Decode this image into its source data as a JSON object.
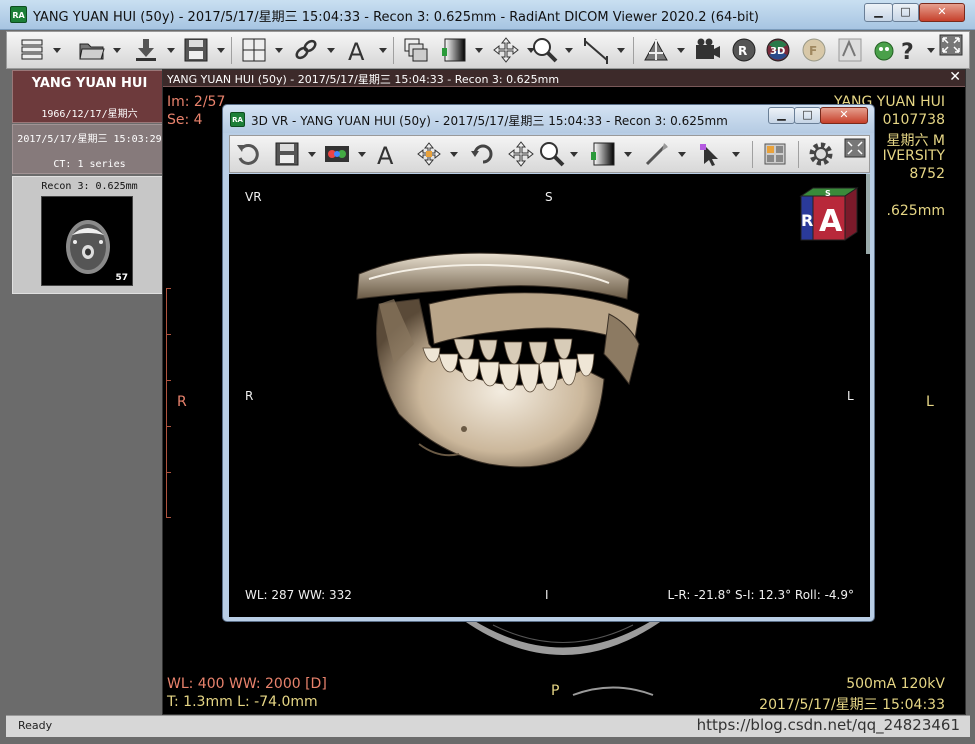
{
  "window": {
    "icon_text": "RA",
    "title": "YANG YUAN HUI (50y) - 2017/5/17/星期三 15:04:33 - Recon 3: 0.625mm - RadiAnt DICOM Viewer 2020.2 (64-bit)",
    "minimize": "▁",
    "maximize": "□",
    "close": "✕"
  },
  "toolbar": {
    "icons": [
      "menu-icon",
      "open-folder-icon",
      "download-icon",
      "save-icon",
      "layout-icon",
      "link-icon",
      "annotation-text-icon",
      "stack-icon",
      "window-level-icon",
      "pan-icon",
      "zoom-icon",
      "measure-icon",
      "mpr-icon",
      "video-icon",
      "mpr-r-icon",
      "3d-icon",
      "fusion-icon",
      "flip-icon",
      "support-icon",
      "help-icon",
      "fullscreen-icon"
    ]
  },
  "patient": {
    "name": "YANG YUAN HUI",
    "dob": "1966/12/17/星期六"
  },
  "study": {
    "datetime": "2017/5/17/星期三 15:03:29",
    "series_info": "CT: 1 series"
  },
  "series": {
    "label": "Recon 3: 0.625mm",
    "count": "57"
  },
  "viewer": {
    "header": "YANG YUAN HUI (50y) - 2017/5/17/星期三 15:04:33 - Recon 3: 0.625mm",
    "close": "✕",
    "im": "Im: 2/57",
    "se": "Se: 4",
    "tr_name": "YANG YUAN HUI",
    "tr_id": "0107738",
    "tr_dob": "星期六 M",
    "tr_inst": "IVERSITY",
    "tr_num": "8752",
    "tr_recon": ".625mm",
    "orient_left": "R",
    "orient_right": "L",
    "orient_bottom": "P",
    "wl_ww": "WL: 400 WW: 2000 [D]",
    "thickness": "T: 1.3mm L: -74.0mm",
    "exposure": "500mA 120kV",
    "datetime": "2017/5/17/星期三 15:04:33"
  },
  "vr": {
    "icon_text": "RA",
    "title": "3D VR - YANG YUAN HUI (50y) - 2017/5/17/星期三 15:04:33 - Recon 3: 0.625mm",
    "minimize": "▁",
    "maximize": "□",
    "close": "✕",
    "corner_label": "VR",
    "orient_top": "S",
    "orient_left": "R",
    "orient_right": "L",
    "orient_bottom": "I",
    "wl_ww": "WL: 287 WW: 332",
    "rotation": "L-R: -21.8° S-I: 12.3° Roll: -4.9°",
    "cube_letter": "A",
    "cube_side": "R",
    "cube_top": "S",
    "toolbar_icons": [
      "rotate-icon",
      "save-icon",
      "render-mode-icon",
      "annotation-text-icon",
      "move-3d-icon",
      "rotate-3d-icon",
      "pan-icon",
      "zoom-icon",
      "window-level-icon",
      "scalpel-icon",
      "select-icon",
      "presets-icon",
      "settings-icon",
      "fullscreen-icon"
    ]
  },
  "statusbar": {
    "text": "Ready",
    "watermark": "https://blog.csdn.net/qq_24823461"
  },
  "colors": {
    "overlay_red": "#e8826c",
    "overlay_yellow": "#e6d685",
    "patient_box": "#6d3a3c",
    "title_bar": "#b7d1ea"
  }
}
